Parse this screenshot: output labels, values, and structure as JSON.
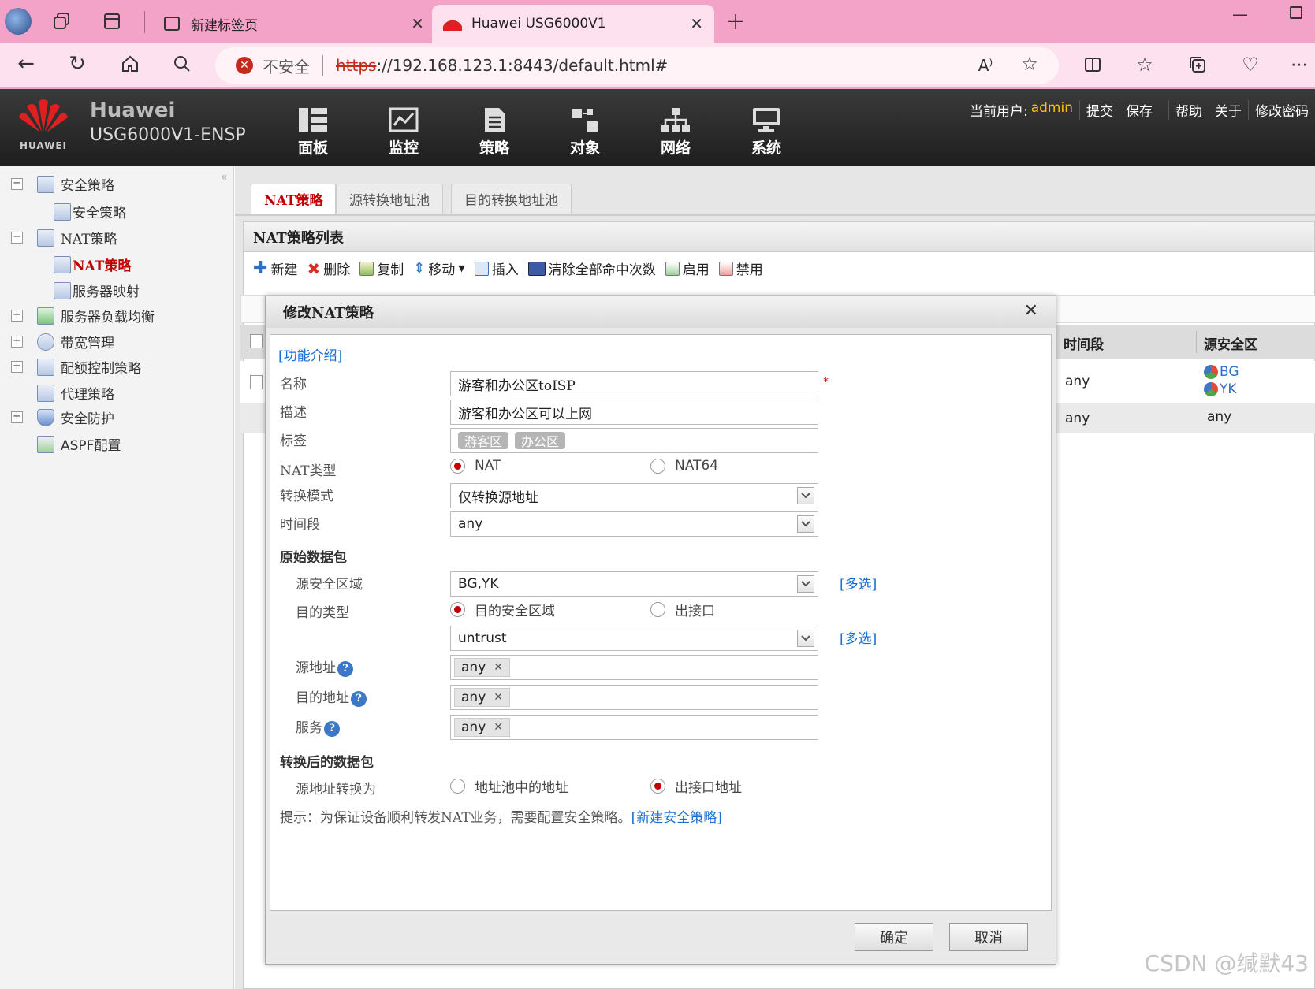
{
  "browser": {
    "tabs": [
      {
        "title": "新建标签页"
      },
      {
        "title": "Huawei USG6000V1"
      }
    ],
    "security_label": "不安全",
    "url_scheme": "https",
    "url_rest": "://192.168.123.1:8443/default.html#"
  },
  "app": {
    "brand": "Huawei",
    "logo_text": "HUAWEI",
    "device": "USG6000V1-ENSP",
    "nav": [
      "面板",
      "监控",
      "策略",
      "对象",
      "网络",
      "系统"
    ],
    "user_label": "当前用户:",
    "username": "admin",
    "actions": [
      "提交",
      "保存",
      "帮助",
      "关于",
      "修改密码"
    ]
  },
  "sidebar": {
    "items": [
      {
        "label": "安全策略",
        "pm": "−"
      },
      {
        "label": "安全策略"
      },
      {
        "label": "NAT策略",
        "pm": "−"
      },
      {
        "label": "NAT策略"
      },
      {
        "label": "服务器映射"
      },
      {
        "label": "服务器负载均衡",
        "pm": "+"
      },
      {
        "label": "带宽管理",
        "pm": "+"
      },
      {
        "label": "配额控制策略",
        "pm": "+"
      },
      {
        "label": "代理策略"
      },
      {
        "label": "安全防护",
        "pm": "+"
      },
      {
        "label": "ASPF配置"
      }
    ]
  },
  "main": {
    "tabs": [
      "NAT策略",
      "源转换地址池",
      "目的转换地址池"
    ],
    "list_title": "NAT策略列表",
    "toolbar": [
      "新建",
      "删除",
      "复制",
      "移动",
      "插入",
      "清除全部命中次数",
      "启用",
      "禁用"
    ],
    "columns": [
      "时间段",
      "源安全区"
    ],
    "rows": [
      {
        "time": "any",
        "zones": [
          "BG",
          "YK"
        ]
      },
      {
        "time": "any",
        "zones_text": "any"
      }
    ]
  },
  "dialog": {
    "title": "修改NAT策略",
    "intro_link": "[功能介绍]",
    "labels": {
      "name": "名称",
      "desc": "描述",
      "tag": "标签",
      "nat_type": "NAT类型",
      "mode": "转换模式",
      "time": "时间段",
      "orig_section": "原始数据包",
      "src_zone": "源安全区域",
      "dst_type": "目的类型",
      "src_addr": "源地址",
      "dst_addr": "目的地址",
      "service": "服务",
      "trans_section": "转换后的数据包",
      "src_trans": "源地址转换为"
    },
    "values": {
      "name": "游客和办公区toISP",
      "desc": "游客和办公区可以上网",
      "tags": [
        "游客区",
        "办公区"
      ],
      "nat_type_options": [
        "NAT",
        "NAT64"
      ],
      "nat_type_selected": "NAT",
      "mode": "仅转换源地址",
      "time": "any",
      "src_zone": "BG,YK",
      "dst_type_options": [
        "目的安全区域",
        "出接口"
      ],
      "dst_type_selected": "目的安全区域",
      "dst_zone": "untrust",
      "src_addr": "any",
      "dst_addr": "any",
      "service": "any",
      "src_trans_options": [
        "地址池中的地址",
        "出接口地址"
      ],
      "src_trans_selected": "出接口地址"
    },
    "required_mark": "*",
    "multi_select_link": "[多选]",
    "hint": "提示：为保证设备顺利转发NAT业务，需要配置安全策略。",
    "hint_link": "[新建安全策略]",
    "ok": "确定",
    "cancel": "取消"
  },
  "watermark": "CSDN @缄默43"
}
